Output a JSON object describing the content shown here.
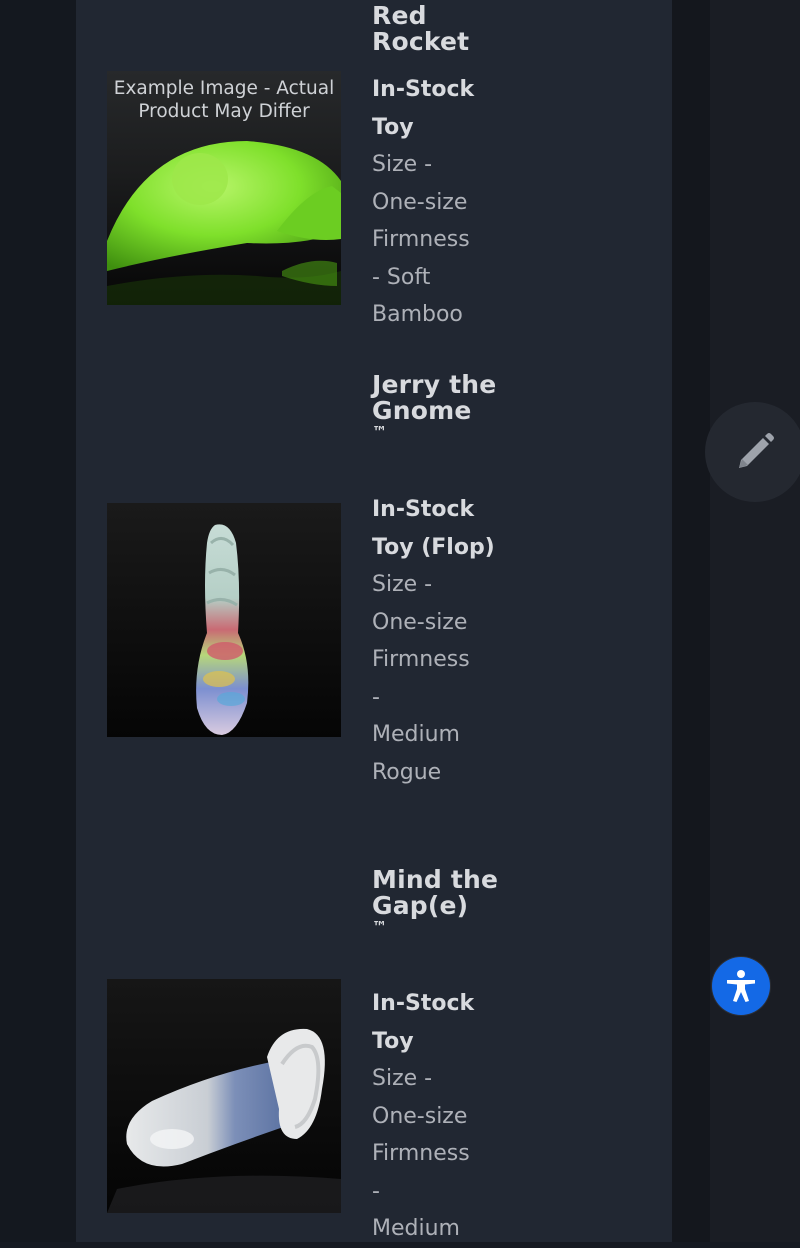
{
  "products": [
    {
      "title": "Red Rocket",
      "tm": "",
      "stock": "In-Stock Toy",
      "details": [
        "Size -",
        "One-size",
        "Firmness",
        "- Soft",
        "Bamboo"
      ],
      "image_caption": "Example Image - Actual Product May Differ",
      "image_subject": "green-toy-image"
    },
    {
      "title": "Jerry the Gnome",
      "tm": "™",
      "stock": "In-Stock Toy (Flop)",
      "details": [
        "Size -",
        "One-size",
        "Firmness",
        "-",
        "Medium",
        "Rogue"
      ],
      "image_subject": "multicolor-toy-image"
    },
    {
      "title": "Mind the Gap(e)",
      "tm": "™",
      "stock": "In-Stock Toy",
      "details": [
        "Size -",
        "One-size",
        "Firmness",
        "-",
        "Medium"
      ],
      "image_subject": "white-blue-toy-image"
    }
  ],
  "icons": {
    "edit": "pencil-icon",
    "accessibility": "accessibility-person-icon"
  },
  "colors": {
    "panel_bg": "#212732",
    "page_bg": "#161a22",
    "title_text": "#d8dade",
    "body_text": "#aeb1b8",
    "accent_blue": "#1469e6"
  }
}
